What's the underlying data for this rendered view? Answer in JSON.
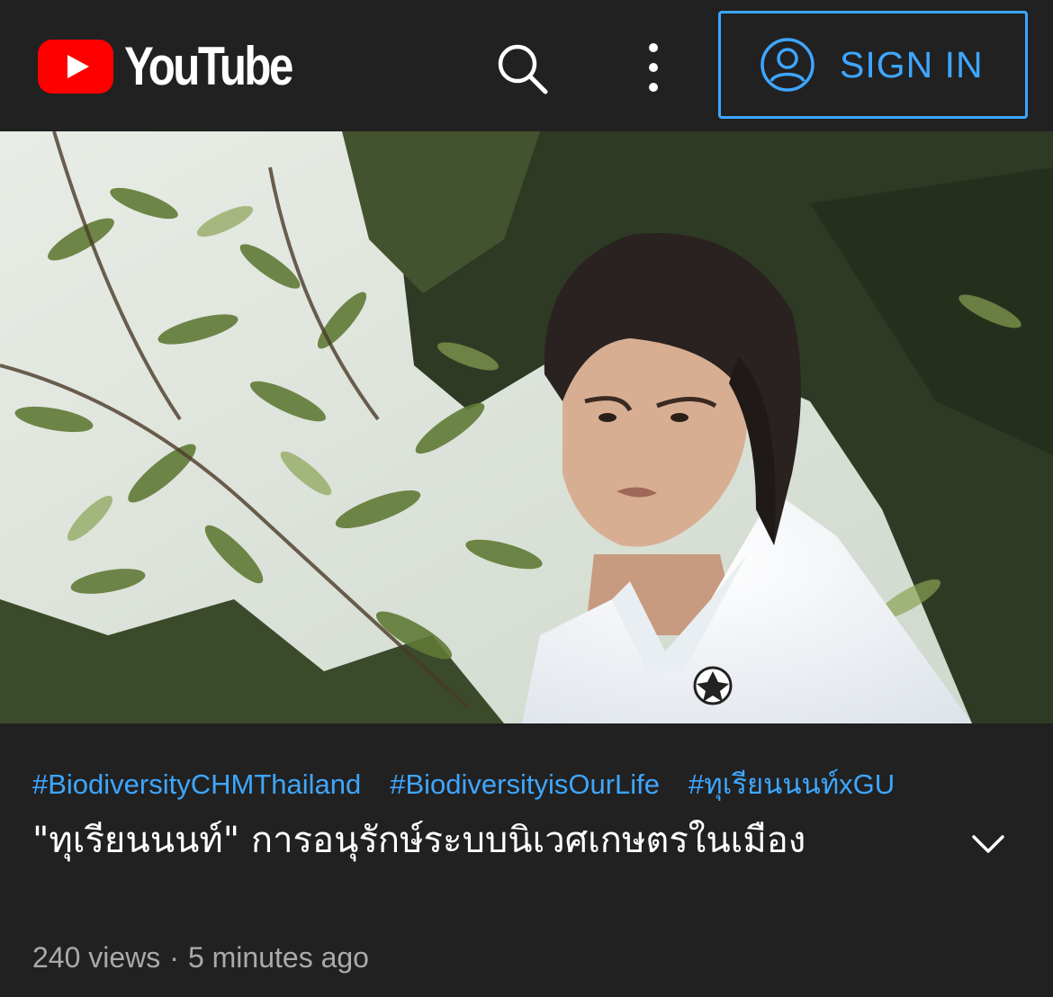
{
  "header": {
    "logo_text": "YouTube",
    "search_icon": "search-icon",
    "more_icon": "more-vert-icon",
    "signin_label": "SIGN IN",
    "signin_icon": "account-circle-icon"
  },
  "video": {
    "description_icon": "video-thumbnail"
  },
  "info": {
    "hashtags": [
      "#BiodiversityCHMThailand",
      "#BiodiversityisOurLife",
      "#ทุเรียนนนท์xGU"
    ],
    "title": "\"ทุเรียนนนท์\" การอนุรักษ์ระบบนิเวศเกษตรในเมือง",
    "views": "240 views",
    "separator": "·",
    "time_ago": "5 minutes ago",
    "expand_icon": "chevron-down-icon"
  },
  "colors": {
    "background": "#212121",
    "accent": "#3ea6ff",
    "brand_red": "#ff0000",
    "meta_text": "#aaaaaa"
  }
}
